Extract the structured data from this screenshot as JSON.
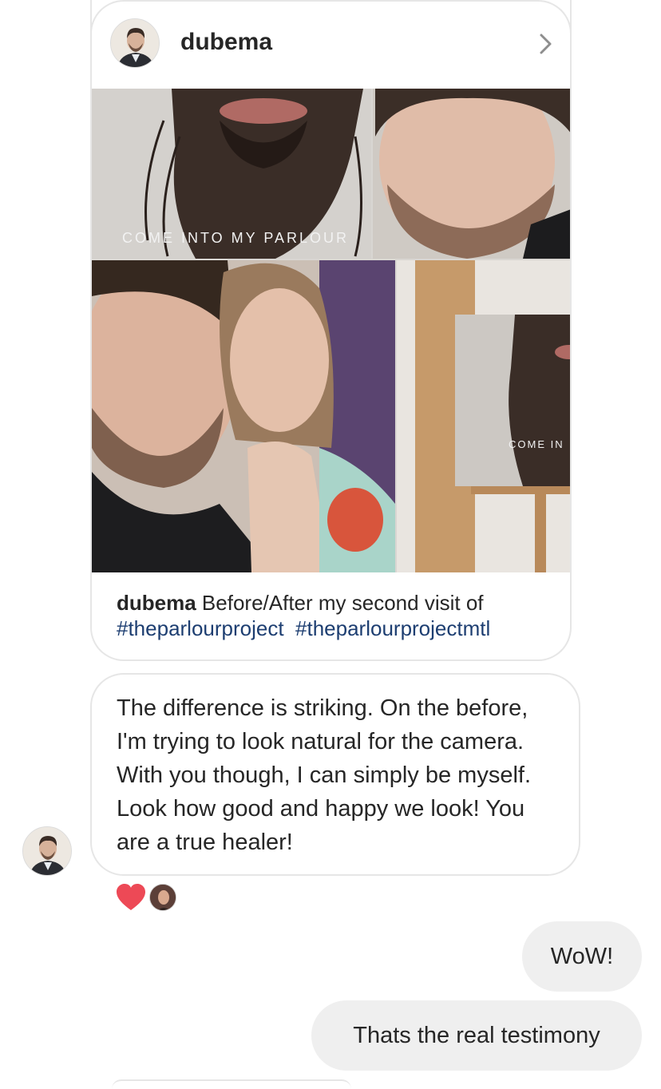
{
  "shared_post": {
    "author": "dubema",
    "image_text": {
      "top_left_overlay": "COME INTO MY PARLOUR",
      "right_panel_overlay": "COME IN"
    },
    "caption": {
      "user": "dubema",
      "text": "Before/After my second visit of",
      "hashtags": [
        "#theparlourproject",
        "#theparlourprojectmtl"
      ]
    }
  },
  "incoming_message": {
    "text": "The difference is striking. On the before, I'm trying to look natural for the camera. With you though, I can simply be myself. Look how good and happy we look! You are a true healer!"
  },
  "reactions": {
    "icon": "heart-icon",
    "color": "#ed4956"
  },
  "outgoing_messages": [
    {
      "text": "WoW!"
    },
    {
      "text": "Thats the real testimony"
    }
  ]
}
